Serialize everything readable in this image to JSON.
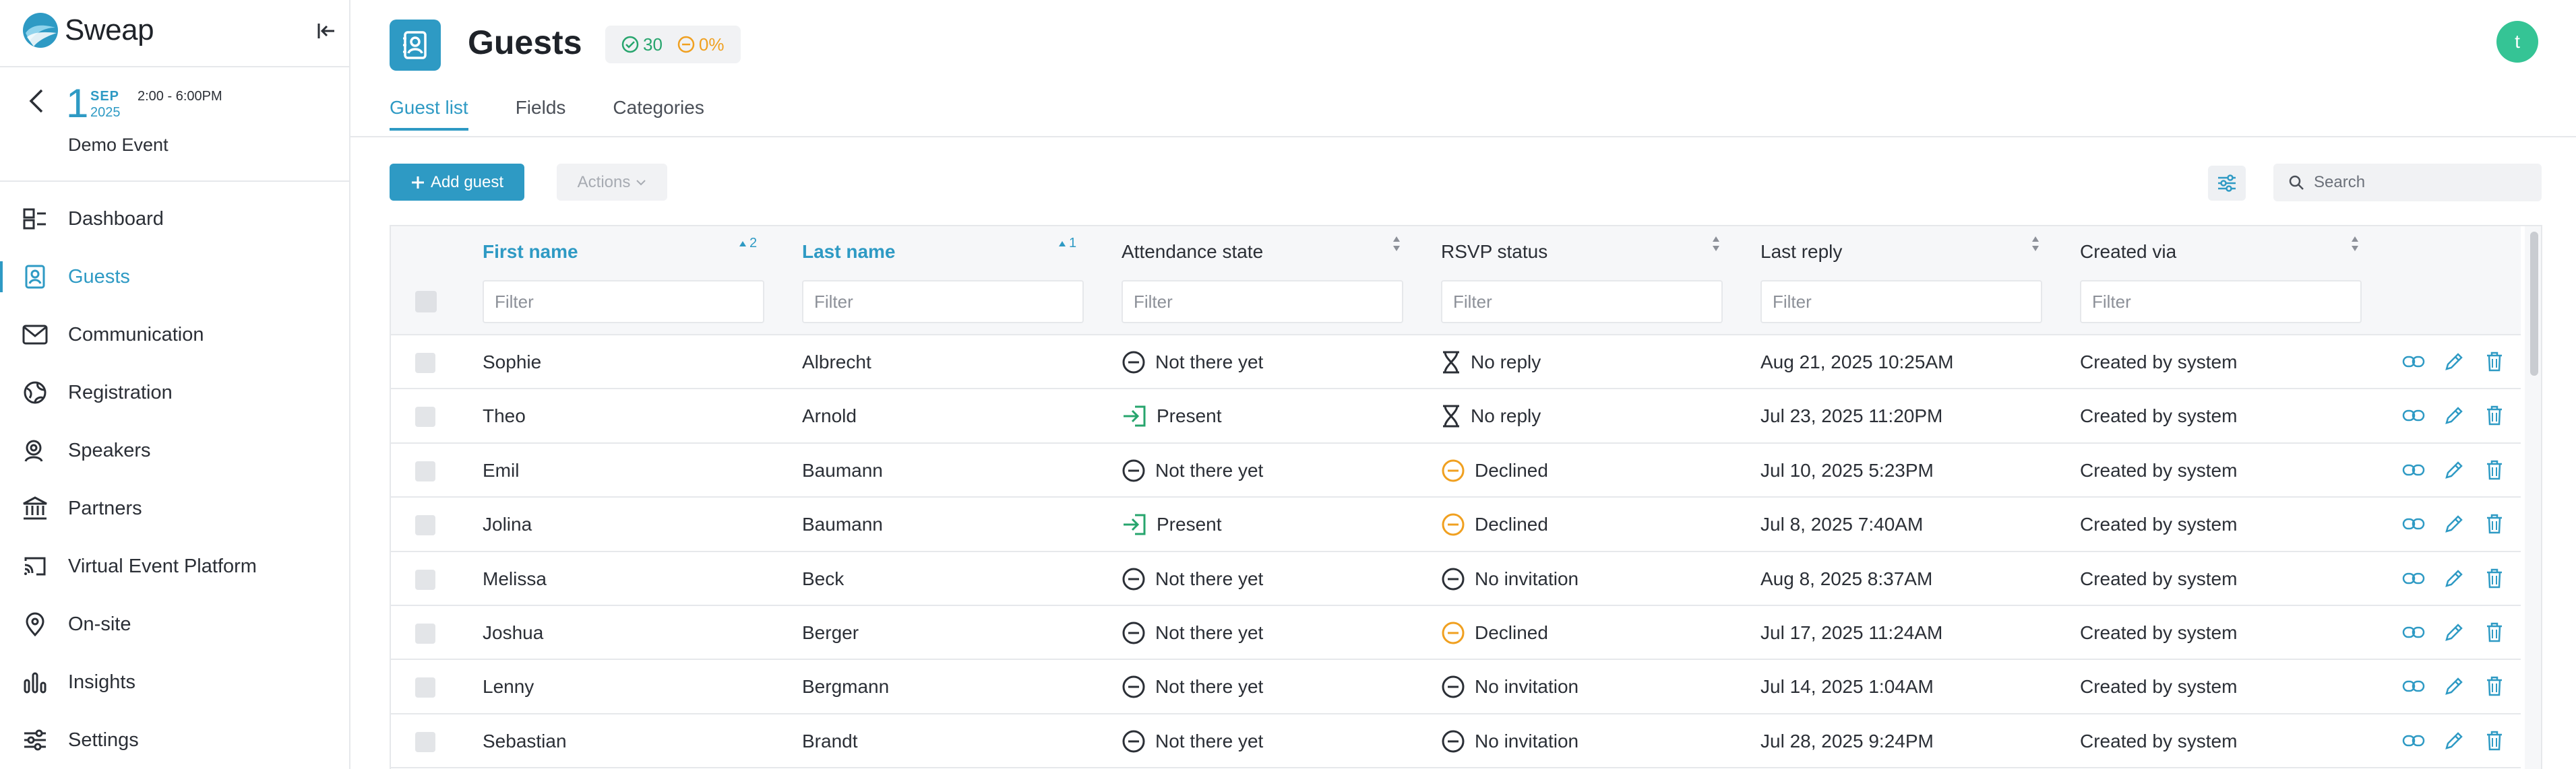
{
  "app": {
    "name": "Sweap"
  },
  "event": {
    "day": "1",
    "month": "SEP",
    "year": "2025",
    "time": "2:00 - 6:00PM",
    "name": "Demo Event"
  },
  "nav": [
    {
      "label": "Dashboard",
      "icon": "dashboard-icon",
      "active": false
    },
    {
      "label": "Guests",
      "icon": "guests-icon",
      "active": true
    },
    {
      "label": "Communication",
      "icon": "mail-icon",
      "active": false
    },
    {
      "label": "Registration",
      "icon": "globe-icon",
      "active": false
    },
    {
      "label": "Speakers",
      "icon": "speaker-icon",
      "active": false
    },
    {
      "label": "Partners",
      "icon": "bank-icon",
      "active": false
    },
    {
      "label": "Virtual Event Platform",
      "icon": "cast-icon",
      "active": false
    },
    {
      "label": "On-site",
      "icon": "location-pin-icon",
      "active": false
    },
    {
      "label": "Insights",
      "icon": "bar-chart-icon",
      "active": false
    },
    {
      "label": "Settings",
      "icon": "sliders-icon",
      "active": false
    }
  ],
  "header": {
    "title": "Guests",
    "stat_accepted": "30",
    "stat_declined": "0%",
    "avatar_initial": "t"
  },
  "tabs": [
    {
      "label": "Guest list",
      "active": true
    },
    {
      "label": "Fields",
      "active": false
    },
    {
      "label": "Categories",
      "active": false
    }
  ],
  "toolbar": {
    "add_label": "Add guest",
    "actions_label": "Actions",
    "search_placeholder": "Search"
  },
  "columns": [
    {
      "label": "First name",
      "sorted": true,
      "sort_order": "2",
      "filter_placeholder": "Filter"
    },
    {
      "label": "Last name",
      "sorted": true,
      "sort_order": "1",
      "filter_placeholder": "Filter"
    },
    {
      "label": "Attendance state",
      "sorted": false,
      "filter_placeholder": "Filter"
    },
    {
      "label": "RSVP status",
      "sorted": false,
      "filter_placeholder": "Filter"
    },
    {
      "label": "Last reply",
      "sorted": false,
      "filter_placeholder": "Filter"
    },
    {
      "label": "Created via",
      "sorted": false,
      "filter_placeholder": "Filter"
    }
  ],
  "rows": [
    {
      "first": "Sophie",
      "last": "Albrecht",
      "attendance": "Not there yet",
      "attendance_icon": "minus-circle",
      "rsvp": "No reply",
      "rsvp_icon": "hourglass",
      "last_reply": "Aug 21, 2025 10:25AM",
      "created": "Created by system"
    },
    {
      "first": "Theo",
      "last": "Arnold",
      "attendance": "Present",
      "attendance_icon": "sign-in",
      "rsvp": "No reply",
      "rsvp_icon": "hourglass",
      "last_reply": "Jul 23, 2025 11:20PM",
      "created": "Created by system"
    },
    {
      "first": "Emil",
      "last": "Baumann",
      "attendance": "Not there yet",
      "attendance_icon": "minus-circle",
      "rsvp": "Declined",
      "rsvp_icon": "minus-circle-orange",
      "last_reply": "Jul 10, 2025 5:23PM",
      "created": "Created by system"
    },
    {
      "first": "Jolina",
      "last": "Baumann",
      "attendance": "Present",
      "attendance_icon": "sign-in",
      "rsvp": "Declined",
      "rsvp_icon": "minus-circle-orange",
      "last_reply": "Jul 8, 2025 7:40AM",
      "created": "Created by system"
    },
    {
      "first": "Melissa",
      "last": "Beck",
      "attendance": "Not there yet",
      "attendance_icon": "minus-circle",
      "rsvp": "No invitation",
      "rsvp_icon": "minus-circle",
      "last_reply": "Aug 8, 2025 8:37AM",
      "created": "Created by system"
    },
    {
      "first": "Joshua",
      "last": "Berger",
      "attendance": "Not there yet",
      "attendance_icon": "minus-circle",
      "rsvp": "Declined",
      "rsvp_icon": "minus-circle-orange",
      "last_reply": "Jul 17, 2025 11:24AM",
      "created": "Created by system"
    },
    {
      "first": "Lenny",
      "last": "Bergmann",
      "attendance": "Not there yet",
      "attendance_icon": "minus-circle",
      "rsvp": "No invitation",
      "rsvp_icon": "minus-circle",
      "last_reply": "Jul 14, 2025 1:04AM",
      "created": "Created by system"
    },
    {
      "first": "Sebastian",
      "last": "Brandt",
      "attendance": "Not there yet",
      "attendance_icon": "minus-circle",
      "rsvp": "No invitation",
      "rsvp_icon": "minus-circle",
      "last_reply": "Jul 28, 2025 9:24PM",
      "created": "Created by system"
    }
  ],
  "colors": {
    "accent": "#2e9ac4",
    "success": "#27a56d",
    "warning": "#f0a020",
    "avatar": "#35c495"
  }
}
